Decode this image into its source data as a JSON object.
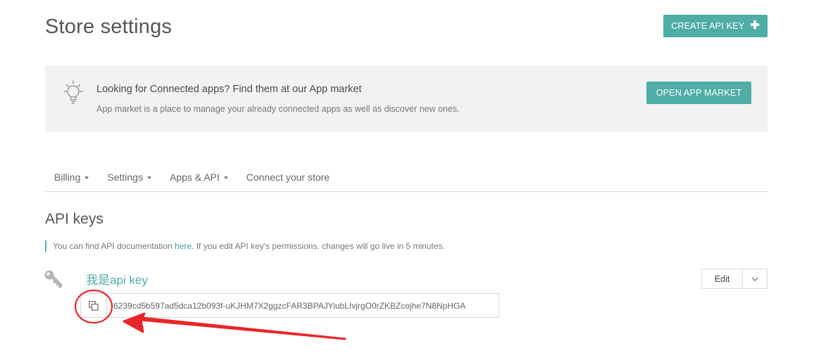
{
  "header": {
    "title": "Store settings",
    "create_button_label": "CREATE API KEY",
    "create_button_icon": "plus-icon"
  },
  "banner": {
    "icon": "lightbulb-icon",
    "title": "Looking for Connected apps? Find them at our App market",
    "description": "App market is a place to manage your already connected apps as well as discover new ones.",
    "button_label": "OPEN APP MARKET"
  },
  "tabs": [
    {
      "label": "Billing",
      "has_dropdown": true
    },
    {
      "label": "Settings",
      "has_dropdown": true
    },
    {
      "label": "Apps & API",
      "has_dropdown": true
    },
    {
      "label": "Connect your store",
      "has_dropdown": false
    }
  ],
  "api_keys": {
    "section_title": "API keys",
    "note_before": "You can find API documentation ",
    "note_link": "here",
    "note_after": ". If you edit API key's permissions, changes will go live in 5 minutes.",
    "key": {
      "name": "我是api key",
      "value": "6239cd5b597ad5dca12b093f-uKJHM7X2ggzcFAR3BPAJYiubLIvjrgO0rZKBZcojhe7N8NpHGA",
      "edit_label": "Edit",
      "icon": "key-icon",
      "copy_icon": "copy-icon"
    }
  },
  "colors": {
    "accent": "#4fada6",
    "banner_bg": "#f1f2f3",
    "annotation": "#e8262a"
  }
}
